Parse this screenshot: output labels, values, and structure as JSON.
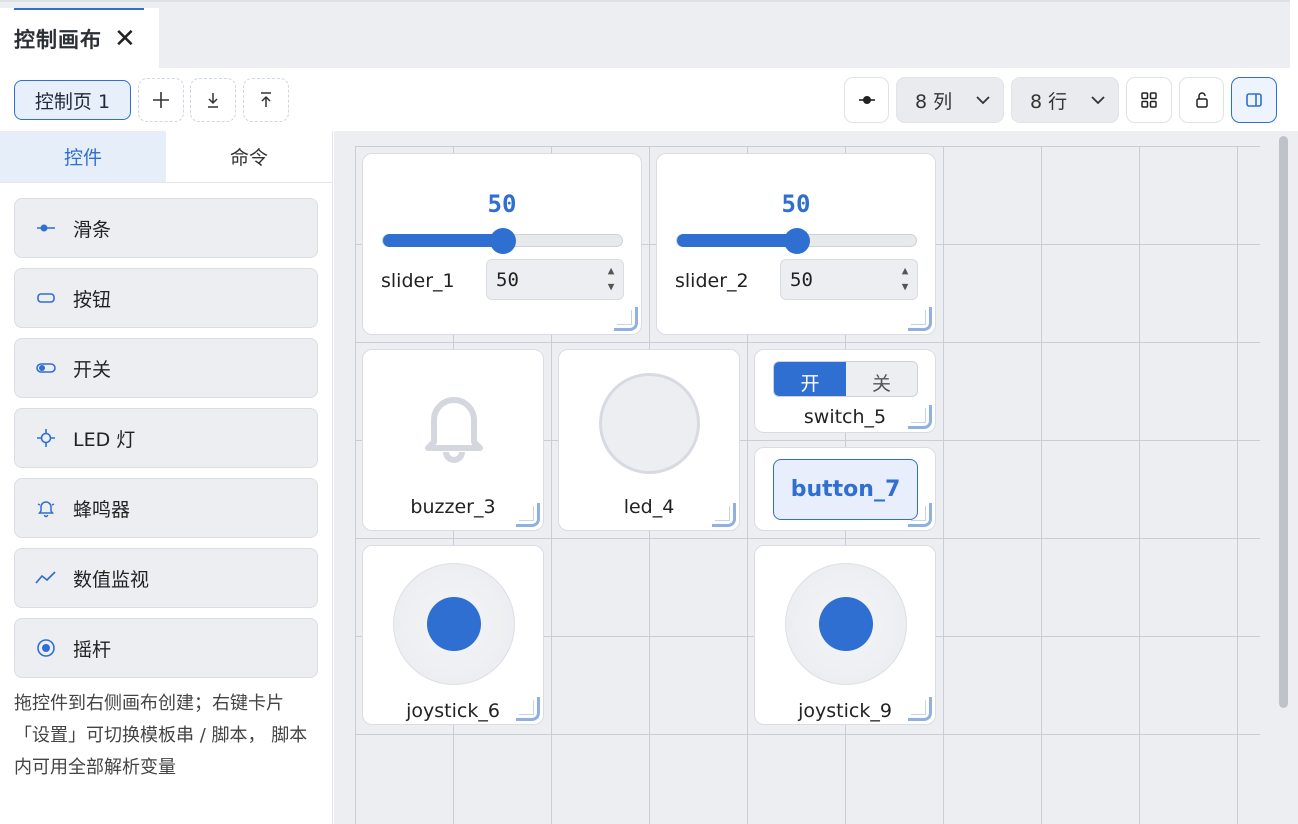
{
  "tab": {
    "title": "控制画布",
    "close_glyph": "✕"
  },
  "toolbar": {
    "page_label": "控制页 1",
    "cols_label": "8 列",
    "rows_label": "8 行"
  },
  "left_panel": {
    "tabs": [
      {
        "label": "控件",
        "active": true
      },
      {
        "label": "命令",
        "active": false
      }
    ],
    "palette": [
      {
        "label": "滑条",
        "icon": "slider-icon"
      },
      {
        "label": "按钮",
        "icon": "button-icon"
      },
      {
        "label": "开关",
        "icon": "switch-icon"
      },
      {
        "label": "LED 灯",
        "icon": "led-icon"
      },
      {
        "label": "蜂鸣器",
        "icon": "buzzer-icon"
      },
      {
        "label": "数值监视",
        "icon": "monitor-icon"
      },
      {
        "label": "摇杆",
        "icon": "joystick-icon"
      }
    ],
    "hint": "拖控件到右侧画布创建；右键卡片「设置」可切换模板串 / 脚本， 脚本内可用全部解析变量"
  },
  "canvas": {
    "widgets": {
      "slider_1": {
        "name": "slider_1",
        "value_display": "50",
        "input_value": "50",
        "value_fraction": 0.5
      },
      "slider_2": {
        "name": "slider_2",
        "value_display": "50",
        "input_value": "50",
        "value_fraction": 0.5
      },
      "buzzer_3": {
        "name": "buzzer_3"
      },
      "led_4": {
        "name": "led_4"
      },
      "switch_5": {
        "name": "switch_5",
        "on_label": "开",
        "off_label": "关",
        "state": "on"
      },
      "joystick_6": {
        "name": "joystick_6"
      },
      "button_7": {
        "name": "button_7",
        "label": "button_7"
      },
      "joystick_9": {
        "name": "joystick_9"
      }
    }
  },
  "colors": {
    "accent": "#2f6fd1",
    "canvas_bg": "#eceef1",
    "grid_line": "#c9ced6",
    "card_bg": "#ffffff"
  }
}
